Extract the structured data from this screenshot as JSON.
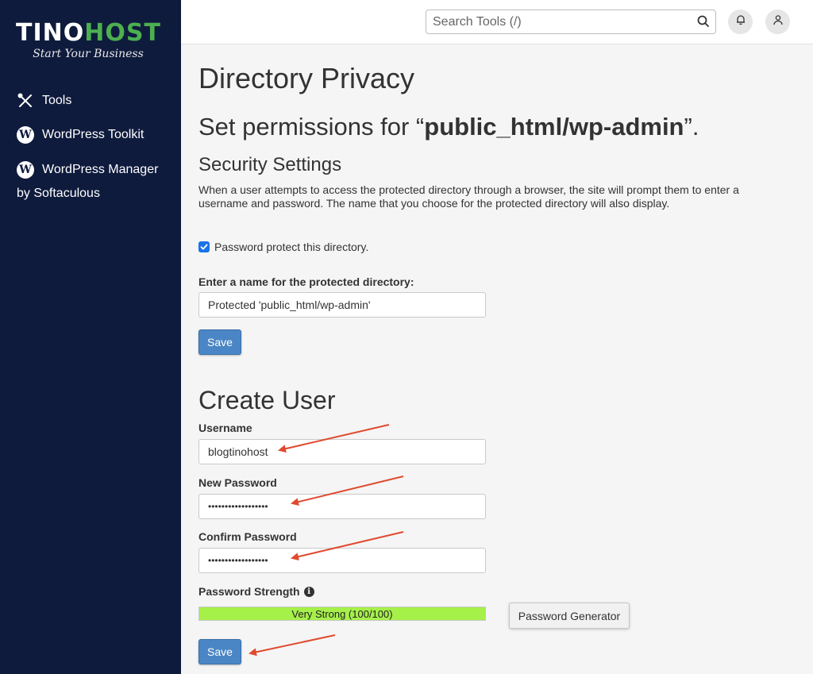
{
  "brand": {
    "name_part1": "TINO",
    "name_part2": "HOST",
    "tagline": "Start Your Business",
    "accent": "#4caf50",
    "sidebar_bg": "#0f1b3d"
  },
  "sidebar": {
    "items": [
      {
        "label": "Tools",
        "icon": "tools-icon"
      },
      {
        "label": "WordPress Toolkit",
        "icon": "wordpress-icon"
      },
      {
        "label": "WordPress Manager",
        "icon": "wordpress-icon"
      }
    ],
    "sub_label": "by Softaculous"
  },
  "topbar": {
    "search_placeholder": "Search Tools (/)",
    "icons": [
      "search-icon",
      "bell-icon",
      "user-icon"
    ]
  },
  "main": {
    "page_title": "Directory Privacy",
    "perm_prefix": "Set permissions for “",
    "perm_path": "public_html/wp-admin",
    "perm_suffix": "”.",
    "security_title": "Security Settings",
    "security_desc": "When a user attempts to access the protected directory through a browser, the site will prompt them to enter a username and password. The name that you choose for the protected directory will also display.",
    "protect_checkbox_label": "Password protect this directory.",
    "protect_checked": true,
    "dir_name_label": "Enter a name for the protected directory:",
    "dir_name_value": "Protected 'public_html/wp-admin'",
    "save_label": "Save"
  },
  "create_user": {
    "title": "Create User",
    "username_label": "Username",
    "username_value": "blogtinohost",
    "new_password_label": "New Password",
    "new_password_value": "••••••••••••••••••",
    "confirm_password_label": "Confirm Password",
    "confirm_password_value": "••••••••••••••••••",
    "strength_label": "Password Strength",
    "strength_text": "Very Strong (100/100)",
    "strength_value": 1.0,
    "strength_color": "#a6f04a",
    "generator_label": "Password Generator",
    "save_label": "Save"
  },
  "annotation_color": "#e04a2f"
}
